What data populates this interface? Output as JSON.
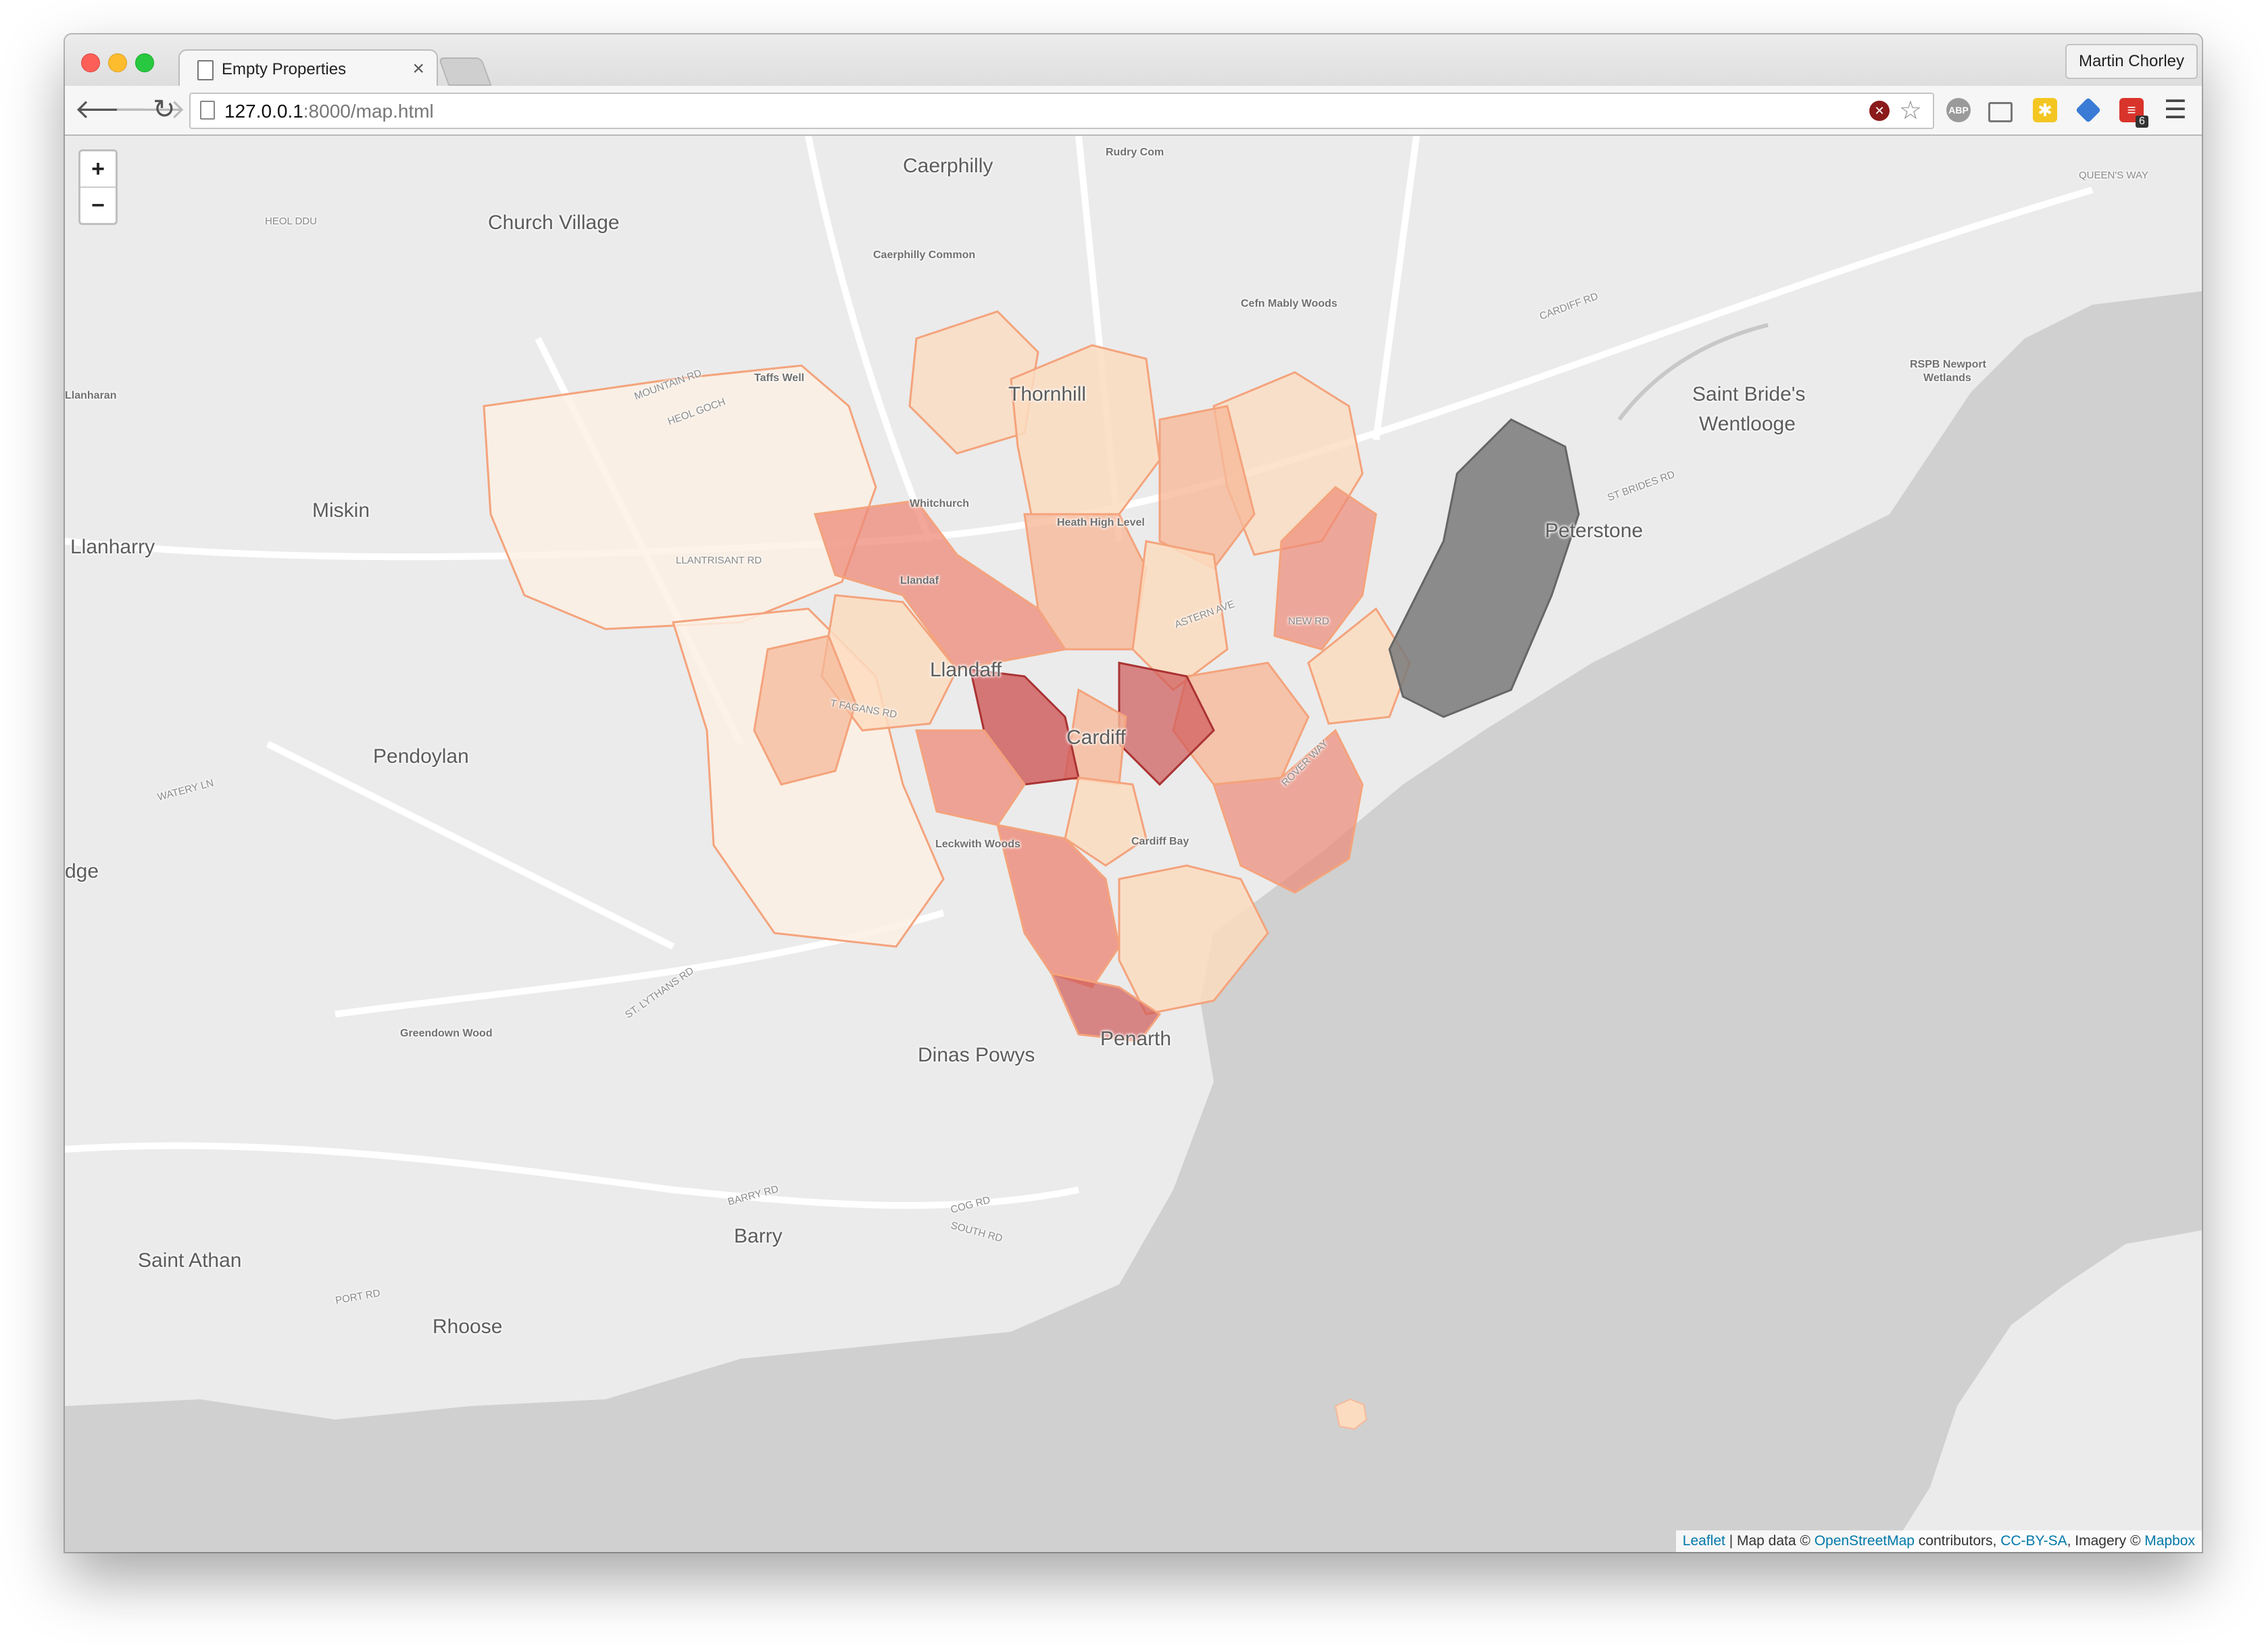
{
  "browser": {
    "tab_title": "Empty Properties",
    "tab_close": "×",
    "profile_name": "Martin Chorley",
    "url_host": "127.0.0.1",
    "url_rest": ":8000/map.html",
    "icons": [
      "back-icon",
      "forward-icon",
      "reload-icon",
      "page-icon",
      "stop-icon",
      "star-icon",
      "adblock-icon",
      "cast-icon",
      "extension-icon",
      "diamond-icon",
      "todoist-icon",
      "menu-icon"
    ],
    "abp_label": "ABP",
    "todo_badge": "6"
  },
  "map": {
    "zoom_in": "+",
    "zoom_out": "−",
    "sea_color": "#d0d0d0",
    "land_color": "#ebebeb",
    "choropleth_colors": [
      "#fdf0e4",
      "#fbdcc0",
      "#f6b99a",
      "#ee8a78",
      "#cf5959",
      "#7a7a7a"
    ],
    "labels": {
      "caerphilly": "Caerphilly",
      "rudry": "Rudry Com",
      "heol_ddu": "HEOL DDU",
      "church_village": "Church Village",
      "caerphilly_common": "Caerphilly Common",
      "cefn_mably": "Cefn Mably Woods",
      "queens_way": "QUEEN'S WAY",
      "thornhill": "Thornhill",
      "taffs_well": "Taffs Well",
      "llanharan": "Llanharan",
      "miskin": "Miskin",
      "llanharry": "Llanharry",
      "saint_brides": "Saint Bride's",
      "wentlooge": "Wentlooge",
      "rspb": "RSPB Newport",
      "wetlands": "Wetlands",
      "peterstone": "Peterstone",
      "whitchurch": "Whitchurch",
      "heath": "Heath High Level",
      "llandaf_small": "Llandaf",
      "llandaff": "Llandaff",
      "cardiff": "Cardiff",
      "pendoylan": "Pendoylan",
      "leckwith": "Leckwith Woods",
      "cardiff_bay": "Cardiff Bay",
      "edge": "dge",
      "greendown": "Greendown Wood",
      "dinas_powys": "Dinas Powys",
      "penarth": "Penarth",
      "barry": "Barry",
      "saint_athan": "Saint Athan",
      "rhoose": "Rhoose",
      "mountain_rd": "MOUNTAIN RD",
      "heol_goch": "HEOL GOCH",
      "astern_ave": "ASTERN AVE",
      "new_rd": "NEW RD",
      "rover_way": "ROVER WAY",
      "t_fagans": "T FAGANS RD",
      "watery_ln": "WATERY LN",
      "st_lythans": "ST. LYTHANS RD",
      "barry_rd": "BARRY RD",
      "cog_rd": "COG RD",
      "south_rd": "SOUTH RD",
      "port_rd": "PORT RD",
      "st_brides_rd": "ST BRIDES RD",
      "cardiff_rd": "CARDIFF RD",
      "llantrisant": "LLANTRISANT RD"
    },
    "attribution": {
      "leaflet": "Leaflet",
      "sep1": " | Map data © ",
      "osm": "OpenStreetMap",
      "sep2": " contributors, ",
      "license": "CC-BY-SA",
      "sep3": ", Imagery © ",
      "mapbox": "Mapbox"
    }
  }
}
